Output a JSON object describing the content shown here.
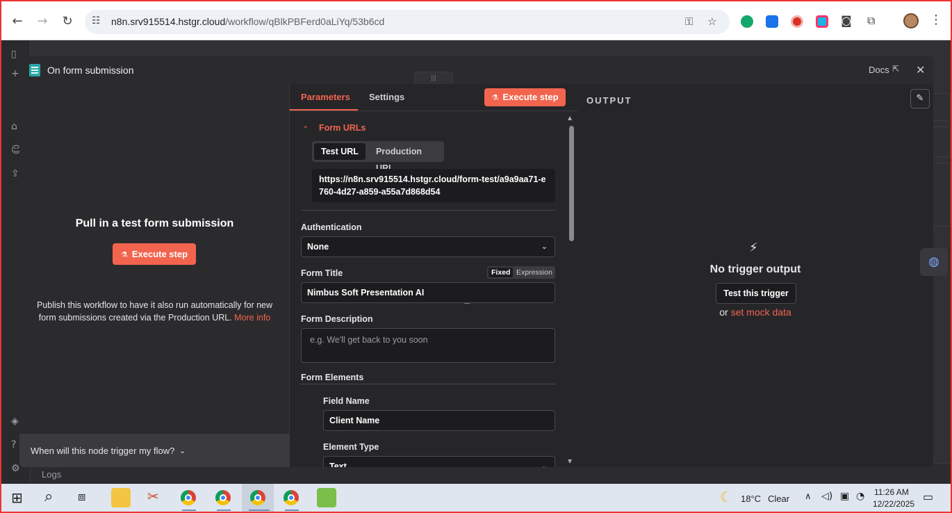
{
  "browser": {
    "url_host": "n8n.srv915514.hstgr.cloud",
    "url_path": "/workflow/qBlkPBFerd0aLiYq/53b6cd"
  },
  "app": {
    "logs_label": "Logs"
  },
  "modal": {
    "title": "On form submission",
    "docs_label": "Docs"
  },
  "input_panel": {
    "heading": "Pull in a test form submission",
    "execute_label": "Execute step",
    "publish_text": "Publish this workflow to have it also run automatically for new form submissions created via the Production URL.",
    "more_info": "More info",
    "trigger_question": "When will this node trigger my flow?"
  },
  "params": {
    "tabs": [
      "Parameters",
      "Settings"
    ],
    "execute_label": "Execute step",
    "form_urls_title": "Form URLs",
    "url_tabs": [
      "Test URL",
      "Production URL"
    ],
    "test_url": "https://n8n.srv915514.hstgr.cloud/form-test/a9a9aa71-e760-4d27-a859-a55a7d868d54",
    "authentication": {
      "label": "Authentication",
      "value": "None"
    },
    "form_title": {
      "label": "Form Title",
      "value": "Nimbus Soft Presentation AI",
      "mode_fixed": "Fixed",
      "mode_expression": "Expression"
    },
    "form_description": {
      "label": "Form Description",
      "placeholder": "e.g. We'll get back to you soon"
    },
    "form_elements": {
      "label": "Form Elements",
      "field_name_label": "Field Name",
      "field_name_value": "Client Name",
      "element_type_label": "Element Type",
      "element_type_value": "Text"
    }
  },
  "output": {
    "label": "OUTPUT",
    "no_output": "No trigger output",
    "test_trigger": "Test this trigger",
    "or": "or",
    "mock_link": "set mock data"
  },
  "taskbar": {
    "weather": "18°C",
    "weather_desc": "Clear",
    "time": "11:26 AM",
    "date": "12/22/2025"
  }
}
